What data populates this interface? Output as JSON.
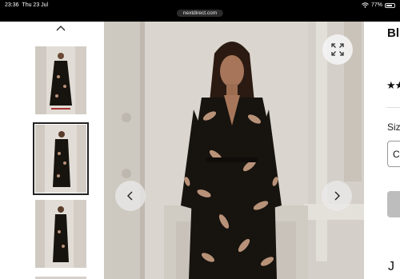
{
  "status_bar": {
    "time": "23:36",
    "date": "Thu 23 Jul",
    "url": "nextdirect.com",
    "battery": "77%"
  },
  "gallery": {
    "thumbnails": [
      {
        "label": "Model wearing robe, view 1"
      },
      {
        "label": "Model wearing robe, view 2",
        "selected": true
      },
      {
        "label": "Model wearing robe, view 3"
      },
      {
        "label": "Model wearing robe, view 4"
      }
    ],
    "icons": {
      "up": "chevron-up-icon",
      "expand": "expand-icon",
      "prev": "chevron-left-icon",
      "next": "chevron-right-icon"
    }
  },
  "product": {
    "title_partial": "Bl",
    "stars_partial": "★★",
    "size_label_partial": "Size",
    "size_select_partial": "C",
    "bottom_partial": "J"
  },
  "colors": {
    "robe": "#17130f",
    "print": "#b89278",
    "wall": "#dad6cf",
    "select_border": "#999999",
    "button_disabled": "#bdbdbd"
  }
}
